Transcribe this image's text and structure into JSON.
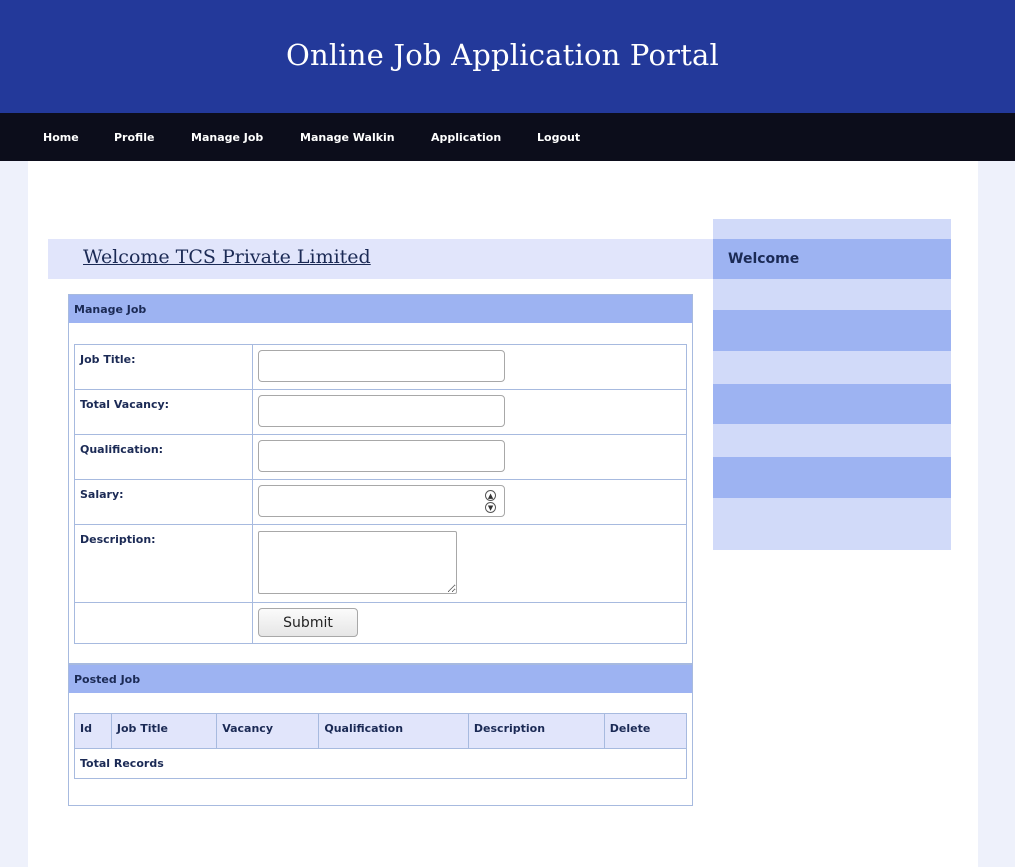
{
  "header": {
    "title": "Online Job Application Portal"
  },
  "nav": {
    "items": [
      "Home",
      "Profile",
      "Manage Job",
      "Manage Walkin",
      "Application",
      "Logout"
    ]
  },
  "welcome": {
    "text": "Welcome TCS Private Limited"
  },
  "sidebar": {
    "welcome_label": "Welcome"
  },
  "manage_job": {
    "heading": "Manage Job",
    "fields": {
      "job_title_label": "Job Title:",
      "total_vacancy_label": "Total Vacancy:",
      "qualification_label": "Qualification:",
      "salary_label": "Salary:",
      "description_label": "Description:"
    },
    "submit_label": "Submit"
  },
  "posted_job": {
    "heading": "Posted Job",
    "columns": [
      "Id",
      "Job Title",
      "Vacancy",
      "Qualification",
      "Description",
      "Delete"
    ],
    "footer_label": "Total Records"
  },
  "colors": {
    "header_bg": "#23399a",
    "nav_bg": "#0c0d1b",
    "panel_head_bg": "#9db3f2",
    "sidebar_light": "#d1daf9",
    "text_dark": "#1b2a55"
  },
  "icons": {
    "salary_spin_up": "chevron-up-icon",
    "salary_spin_down": "chevron-down-icon"
  }
}
